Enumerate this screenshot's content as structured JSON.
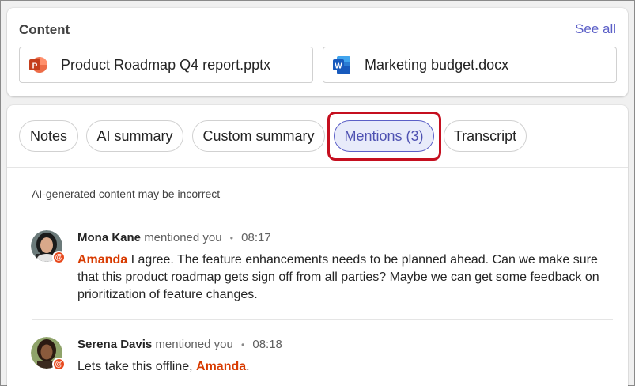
{
  "content": {
    "title": "Content",
    "see_all": "See all",
    "files": [
      {
        "name": "Product Roadmap Q4 report.pptx",
        "icon": "powerpoint-icon"
      },
      {
        "name": "Marketing budget.docx",
        "icon": "word-icon"
      }
    ]
  },
  "tabs": [
    {
      "label": "Notes"
    },
    {
      "label": "AI summary"
    },
    {
      "label": "Custom summary"
    },
    {
      "label": "Mentions (3)",
      "selected": true
    },
    {
      "label": "Transcript"
    }
  ],
  "disclaimer": "AI-generated content may be incorrect",
  "mentions": [
    {
      "name": "Mona Kane",
      "verb": "mentioned you",
      "time": "08:17",
      "tag": "Amanda",
      "text": " I agree. The feature enhancements needs to be planned ahead. Can we make sure that this product roadmap gets sign off from all parties? Maybe we can get some  feedback on prioritization of feature changes."
    },
    {
      "name": "Serena Davis",
      "verb": "mentioned you",
      "time": "08:18",
      "pre": "Lets take this offline, ",
      "tag": "Amanda",
      "post": "."
    }
  ],
  "badge_symbol": "@",
  "colors": {
    "accent": "#5b5fc7",
    "mention_tag": "#d83b01",
    "highlight": "#c50f1f",
    "badge": "#e8491d"
  }
}
